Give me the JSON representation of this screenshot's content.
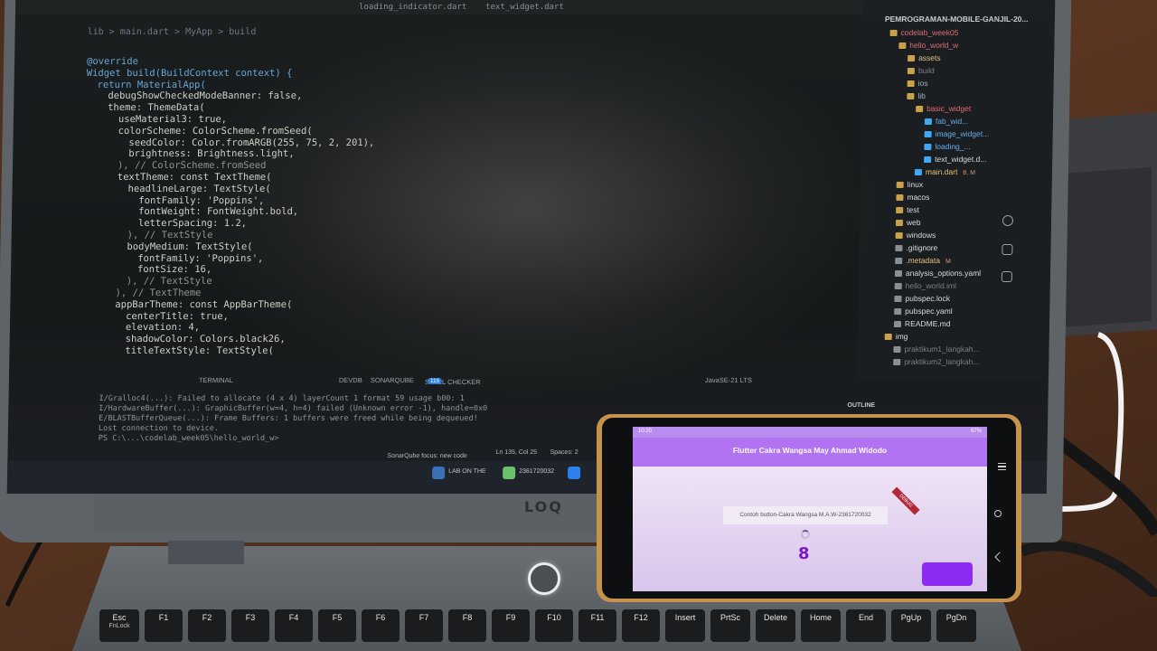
{
  "editor": {
    "tabs": [
      "loading_indicator.dart",
      "text_widget.dart"
    ],
    "breadcrumb": "lib > main.dart > MyApp > build",
    "code_lines": [
      {
        "indent": 0,
        "text": "@override"
      },
      {
        "indent": 0,
        "text": "Widget build(BuildContext context) {"
      },
      {
        "indent": 1,
        "text": "return MaterialApp("
      },
      {
        "indent": 2,
        "text": "debugShowCheckedModeBanner: false,"
      },
      {
        "indent": 2,
        "text": "theme: ThemeData("
      },
      {
        "indent": 3,
        "text": "useMaterial3: true,"
      },
      {
        "indent": 3,
        "text": "colorScheme: ColorScheme.fromSeed("
      },
      {
        "indent": 4,
        "text": "seedColor: Color.fromARGB(255, 75, 2, 201),"
      },
      {
        "indent": 4,
        "text": "brightness: Brightness.light,"
      },
      {
        "indent": 3,
        "text": "), // ColorScheme.fromSeed"
      },
      {
        "indent": 3,
        "text": "textTheme: const TextTheme("
      },
      {
        "indent": 4,
        "text": "headlineLarge: TextStyle("
      },
      {
        "indent": 5,
        "text": "fontFamily: 'Poppins',"
      },
      {
        "indent": 5,
        "text": "fontWeight: FontWeight.bold,"
      },
      {
        "indent": 5,
        "text": "letterSpacing: 1.2,"
      },
      {
        "indent": 4,
        "text": "), // TextStyle"
      },
      {
        "indent": 4,
        "text": "bodyMedium: TextStyle("
      },
      {
        "indent": 5,
        "text": "fontFamily: 'Poppins',"
      },
      {
        "indent": 5,
        "text": "fontSize: 16,"
      },
      {
        "indent": 4,
        "text": "), // TextStyle"
      },
      {
        "indent": 3,
        "text": "), // TextTheme"
      },
      {
        "indent": 3,
        "text": "appBarTheme: const AppBarTheme("
      },
      {
        "indent": 4,
        "text": "centerTitle: true,"
      },
      {
        "indent": 4,
        "text": "elevation: 4,"
      },
      {
        "indent": 4,
        "text": "shadowColor: Colors.black26,"
      },
      {
        "indent": 4,
        "text": "titleTextStyle: TextStyle("
      }
    ]
  },
  "explorer": {
    "root": "PEMROGRAMAN-MOBILE-GANJIL-20...",
    "items": [
      {
        "label": "codelab_week05",
        "depth": 1,
        "color": "#e06c75",
        "icon": "folder-icon"
      },
      {
        "label": "hello_world_w",
        "depth": 2,
        "color": "#e06c75",
        "icon": "folder-icon"
      },
      {
        "label": "assets",
        "depth": 3,
        "color": "#d7c58a",
        "icon": "folder-icon"
      },
      {
        "label": "build",
        "depth": 3,
        "color": "#7b7f85",
        "icon": "folder-icon"
      },
      {
        "label": "ios",
        "depth": 3,
        "color": "#9fb3c8",
        "icon": "folder-icon"
      },
      {
        "label": "lib",
        "depth": 3,
        "color": "#9fb3c8",
        "icon": "folder-icon"
      },
      {
        "label": "basic_widget",
        "depth": 4,
        "color": "#e06c75",
        "icon": "folder-icon"
      },
      {
        "label": "fab_wid...",
        "depth": 5,
        "color": "#61afef",
        "icon": "dart-file-icon"
      },
      {
        "label": "image_widget...",
        "depth": 5,
        "color": "#61afef",
        "icon": "dart-file-icon"
      },
      {
        "label": "loading_...",
        "depth": 5,
        "color": "#61afef",
        "icon": "dart-file-icon"
      },
      {
        "label": "text_widget.d...",
        "depth": 5,
        "color": "#d7dae0",
        "icon": "dart-file-icon"
      },
      {
        "label": "main.dart",
        "depth": 4,
        "color": "#e5c07b",
        "icon": "dart-file-icon",
        "badge": "8, M"
      },
      {
        "label": "linux",
        "depth": 2,
        "color": "#d7dae0",
        "icon": "folder-icon"
      },
      {
        "label": "macos",
        "depth": 2,
        "color": "#d7dae0",
        "icon": "folder-icon"
      },
      {
        "label": "test",
        "depth": 2,
        "color": "#d7dae0",
        "icon": "folder-icon"
      },
      {
        "label": "web",
        "depth": 2,
        "color": "#d7dae0",
        "icon": "folder-icon"
      },
      {
        "label": "windows",
        "depth": 2,
        "color": "#d7dae0",
        "icon": "folder-icon"
      },
      {
        "label": ".gitignore",
        "depth": 2,
        "color": "#d7dae0",
        "icon": "git-icon"
      },
      {
        "label": ".metadata",
        "depth": 2,
        "color": "#e5c07b",
        "icon": "file-icon",
        "badge": "M"
      },
      {
        "label": "analysis_options.yaml",
        "depth": 2,
        "color": "#d7dae0",
        "icon": "yaml-icon"
      },
      {
        "label": "hello_world.iml",
        "depth": 2,
        "color": "#7b7f85",
        "icon": "file-icon"
      },
      {
        "label": "pubspec.lock",
        "depth": 2,
        "color": "#d7dae0",
        "icon": "file-icon"
      },
      {
        "label": "pubspec.yaml",
        "depth": 2,
        "color": "#d7dae0",
        "icon": "yaml-icon"
      },
      {
        "label": "README.md",
        "depth": 2,
        "color": "#d7dae0",
        "icon": "info-icon"
      },
      {
        "label": "img",
        "depth": 1,
        "color": "#d7dae0",
        "icon": "folder-icon"
      },
      {
        "label": "praktikum1_langkah...",
        "depth": 2,
        "color": "#7b7f85",
        "icon": "image-file-icon"
      },
      {
        "label": "praktikum2_langkah...",
        "depth": 2,
        "color": "#7b7f85",
        "icon": "image-file-icon"
      }
    ],
    "outline_label": "OUTLINE"
  },
  "panel": {
    "tabs": [
      "TERMINAL",
      "DEVDB",
      "SONARQUBE",
      "SPELL CHECKER"
    ],
    "spell_count": "116",
    "terminal_profile": "JavaSE-21 LTS",
    "terminal_lines": [
      "I/Gralloc4(...): Failed to allocate (4 x 4) layerCount 1 format 59 usage b00: 1",
      "I/HardwareBuffer(...): GraphicBuffer(w=4, h=4) failed (Unknown error -1), handle=0x0",
      "E/BLASTBufferQueue(...): Frame Buffers: 1 buffers were freed while being dequeued!",
      "Lost connection to device.",
      "",
      "PS C:\\...\\codelab_week05\\hello_world_w>"
    ],
    "status_items": [
      "Ln 135, Col 25",
      "Spaces: 2",
      "SonarQube focus: new code"
    ],
    "taskbar_items": [
      "LAB ON THE",
      "2361720032"
    ]
  },
  "laptop": {
    "brand": "LOQ",
    "keys": [
      "Esc",
      "F1",
      "F2",
      "F3",
      "F4",
      "F5",
      "F6",
      "F7",
      "F8",
      "F9",
      "F10",
      "F11",
      "F12",
      "Insert",
      "PrtSc",
      "Delete",
      "Home",
      "End",
      "PgUp",
      "PgDn"
    ],
    "esc_sub": "FnLock"
  },
  "phone": {
    "app_title": "Flutter Cakra Wangsa May Ahmad Widodo",
    "label_text": "Contoh button-Cakra Wangsa M.A.W-2361720032",
    "counter": "8",
    "status_time": "10:20",
    "status_right": "67%",
    "debug_label": "DEBUG",
    "colors": {
      "appbar": "#b273f3",
      "counter": "#7a18c8",
      "fab": "#8c2cf2"
    }
  }
}
